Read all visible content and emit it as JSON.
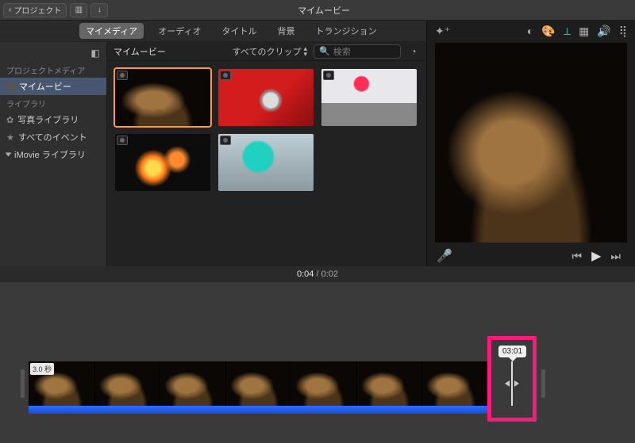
{
  "titlebar": {
    "back_label": "プロジェクト",
    "app_title": "マイムービー"
  },
  "tabs": {
    "items": [
      "マイメディア",
      "オーディオ",
      "タイトル",
      "背景",
      "トランジション"
    ],
    "active_index": 0
  },
  "sidebar": {
    "section1_label": "プロジェクトメディア",
    "project_item": "マイムービー",
    "section2_label": "ライブラリ",
    "photos_item": "写真ライブラリ",
    "events_item": "すべてのイベント",
    "imovie_lib_item": "iMovie ライブラリ"
  },
  "browser": {
    "library_title": "マイムービー",
    "clip_filter": "すべてのクリップ",
    "search_placeholder": "検索",
    "thumbs": [
      "leopard",
      "redcar",
      "pinkumb",
      "fire",
      "teal"
    ]
  },
  "viewer": {
    "timecode_current": "0:04",
    "timecode_total": "0:02"
  },
  "timeline": {
    "clip_duration_badge": "3.0 秒",
    "trim_tooltip": "03:01"
  }
}
